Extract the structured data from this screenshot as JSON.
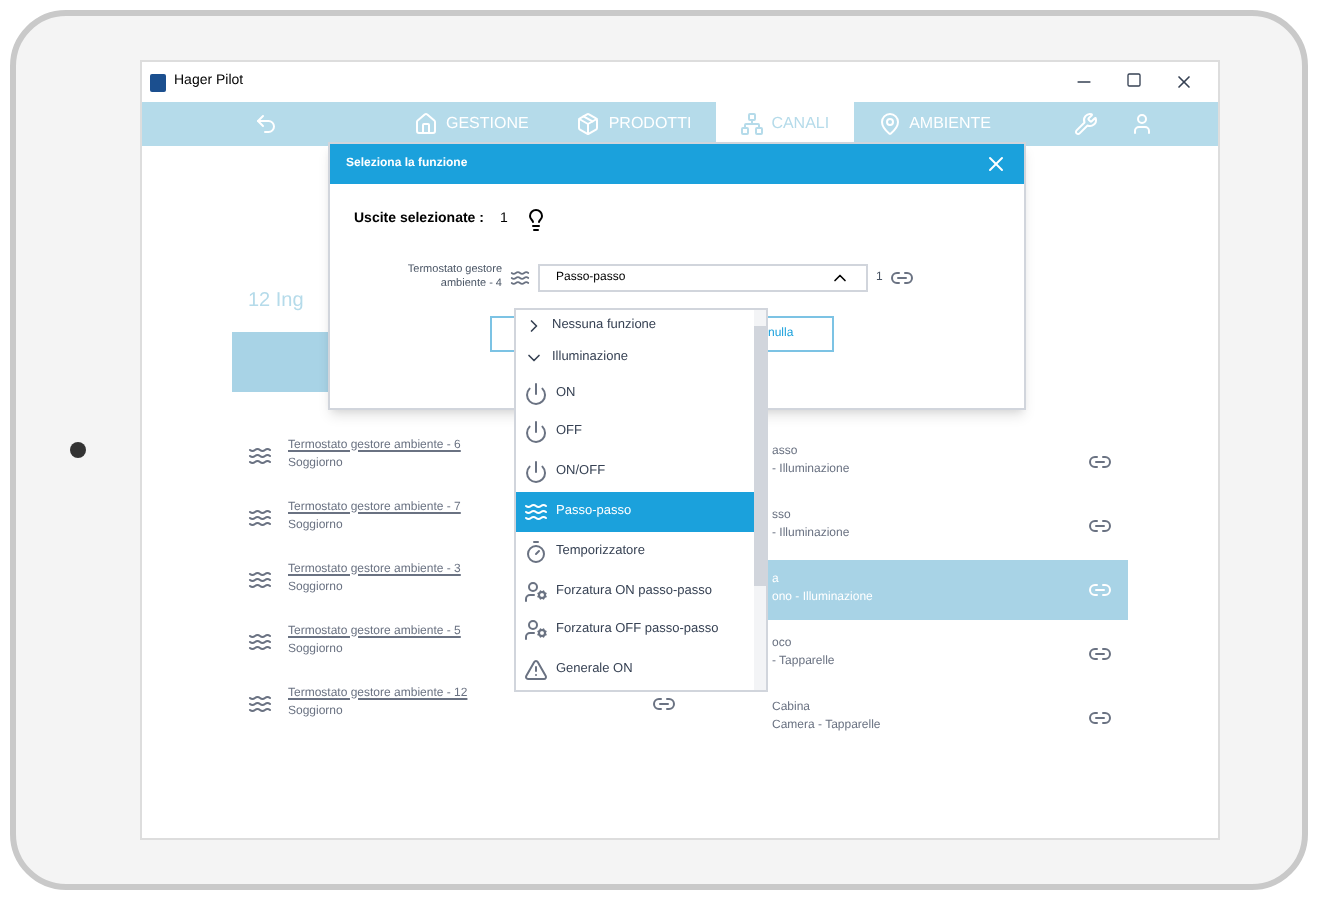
{
  "window": {
    "title": "Hager Pilot"
  },
  "nav": {
    "items": [
      {
        "label": "GESTIONE",
        "selected": false
      },
      {
        "label": "PRODOTTI",
        "selected": false
      },
      {
        "label": "CANALI",
        "selected": true
      },
      {
        "label": "AMBIENTE",
        "selected": false
      }
    ]
  },
  "inputs_panel": {
    "heading": "12 Ing",
    "rows": [
      {
        "name": "Termostato gestore ambiente - 6",
        "room": "Soggiorno"
      },
      {
        "name": "Termostato gestore ambiente - 7",
        "room": "Soggiorno"
      },
      {
        "name": "Termostato gestore ambiente - 3",
        "room": "Soggiorno"
      },
      {
        "name": "Termostato gestore ambiente - 5",
        "room": "Soggiorno"
      },
      {
        "name": "Termostato gestore ambiente - 12",
        "room": "Soggiorno"
      }
    ]
  },
  "outputs_panel": {
    "rows": [
      {
        "name": "asso",
        "room": "- Illuminazione",
        "selected": false
      },
      {
        "name": "sso",
        "room": "- Illuminazione",
        "selected": false
      },
      {
        "name": "a",
        "room": "ono - Illuminazione",
        "selected": true
      },
      {
        "name": "oco",
        "room": "- Tapparelle",
        "selected": false
      },
      {
        "name": "Cabina",
        "room": "Camera - Tapparelle",
        "selected": false
      }
    ]
  },
  "dialog": {
    "title": "Seleziona la funzione",
    "selected_outputs_label": "Uscite selezionate :",
    "selected_outputs_count": "1",
    "input_label": "Termostato gestore ambiente - 4",
    "select_value": "Passo-passo",
    "link_count": "1",
    "button": "nulla",
    "dropdown": [
      {
        "label": "Nessuna funzione",
        "kind": "group",
        "expanded": false,
        "selected": false
      },
      {
        "label": "Illuminazione",
        "kind": "group",
        "expanded": true,
        "selected": false
      },
      {
        "label": "ON",
        "kind": "power",
        "selected": false
      },
      {
        "label": "OFF",
        "kind": "power",
        "selected": false
      },
      {
        "label": "ON/OFF",
        "kind": "power",
        "selected": false
      },
      {
        "label": "Passo-passo",
        "kind": "toggle",
        "selected": true
      },
      {
        "label": "Temporizzatore",
        "kind": "timer",
        "selected": false
      },
      {
        "label": "Forzatura ON passo-passo",
        "kind": "force",
        "selected": false
      },
      {
        "label": "Forzatura OFF passo-passo",
        "kind": "force",
        "selected": false
      },
      {
        "label": "Generale ON",
        "kind": "general",
        "selected": false
      }
    ]
  }
}
